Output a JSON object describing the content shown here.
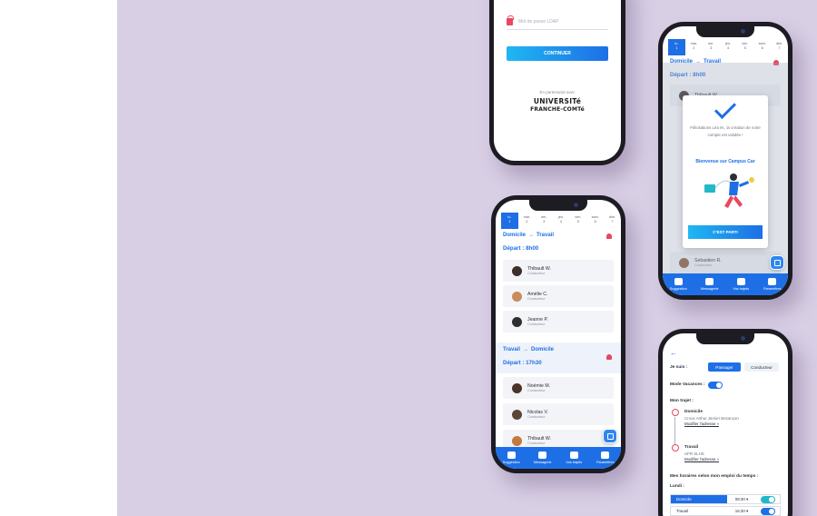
{
  "login": {
    "password_placeholder": "Mot de passe LDAP",
    "continue_label": "CONTINUER",
    "partner_text": "En partenariat avec",
    "logo_line1": "UNIVERSITé",
    "logo_line2": "FRANCHE-COMTé"
  },
  "days": [
    {
      "d": "lu.",
      "n": "1"
    },
    {
      "d": "mar.",
      "n": "2"
    },
    {
      "d": "me.",
      "n": "3"
    },
    {
      "d": "jeu.",
      "n": "4"
    },
    {
      "d": "ven.",
      "n": "5"
    },
    {
      "d": "sam.",
      "n": "6"
    },
    {
      "d": "dim.",
      "n": "7"
    }
  ],
  "schedule": {
    "route1_from": "Domicile",
    "route1_to": "Travail",
    "route1_depart": "Départ : 8h00",
    "route2_from": "Travail",
    "route2_to": "Domicile",
    "route2_depart": "Départ : 17h30",
    "drivers_morning": [
      {
        "name": "Thibault W.",
        "role": "Conducteur"
      },
      {
        "name": "Amélie C.",
        "role": "Conducteur"
      },
      {
        "name": "Jeanne P.",
        "role": "Conducteur"
      }
    ],
    "drivers_evening": [
      {
        "name": "Noémie M.",
        "role": "Conducteur"
      },
      {
        "name": "Nicolas V.",
        "role": "Conducteur"
      },
      {
        "name": "Thibault W.",
        "role": "Conducteur"
      }
    ],
    "phoneC_last_driver": {
      "name": "Sebastien R.",
      "role": "Conducteur"
    }
  },
  "tabs": [
    "Suggestion",
    "Messagerie",
    "Vos trajets",
    "Paramètres"
  ],
  "modal": {
    "congrats": "Félicitations Léa M., la création de votre compte est validée !",
    "welcome": "Bienvenue sur Campus Car",
    "go_label": "C'EST PARTI"
  },
  "prefs": {
    "je_suis": "Je suis :",
    "passager": "Passager",
    "conducteur": "Conducteur",
    "mode_vacances": "Mode Vacances :",
    "mon_trajet": "Mon trajet :",
    "stop1_title": "Domicile",
    "stop1_addr": "Crous Arthur Jamier Besançon",
    "stop1_link": "Modifier l'adresse »",
    "stop2_title": "Travail",
    "stop2_addr": "UFR SLHS",
    "stop2_link": "Modifier l'adresse »",
    "horaires": "Mes horaires selon mon emploi du temps :",
    "lundi": "Lundi :",
    "row1_label": "Domicile",
    "row1_time": "08:30 ▾",
    "row2_label": "Travail",
    "row2_time": "16:30 ▾"
  },
  "colors": {
    "accent": "#1e6fe6",
    "alert": "#e8475f",
    "backdrop": "#d9cfe5"
  }
}
